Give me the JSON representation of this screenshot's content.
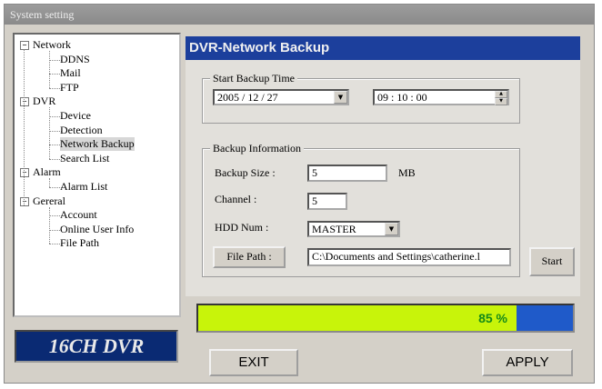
{
  "window": {
    "title": "System setting"
  },
  "tree": [
    {
      "label": "Network",
      "level": 0,
      "toggle": "−"
    },
    {
      "label": "DDNS",
      "level": 1
    },
    {
      "label": "Mail",
      "level": 1
    },
    {
      "label": "FTP",
      "level": 1
    },
    {
      "label": "DVR",
      "level": 0,
      "toggle": "−"
    },
    {
      "label": "Device",
      "level": 1
    },
    {
      "label": "Detection",
      "level": 1
    },
    {
      "label": "Network Backup",
      "level": 1,
      "selected": true
    },
    {
      "label": "Search List",
      "level": 1
    },
    {
      "label": "Alarm",
      "level": 0,
      "toggle": "−"
    },
    {
      "label": "Alarm List",
      "level": 1
    },
    {
      "label": "Gereral",
      "level": 0,
      "toggle": "−"
    },
    {
      "label": "Account",
      "level": 1
    },
    {
      "label": "Online User Info",
      "level": 1
    },
    {
      "label": "File Path",
      "level": 1
    }
  ],
  "brand": "16CH DVR",
  "panel": {
    "title": "DVR-Network Backup",
    "start_group": {
      "legend": "Start Backup Time",
      "date": "2005 / 12 / 27",
      "time": "09 : 10 : 00"
    },
    "info_group": {
      "legend": "Backup Information",
      "size_label": "Backup Size :",
      "size_value": "5",
      "size_unit": "MB",
      "channel_label": "Channel :",
      "channel_value": "5",
      "hdd_label": "HDD Num :",
      "hdd_value": "MASTER",
      "filepath_button": "File Path :",
      "filepath_value": "C:\\Documents and Settings\\catherine.l"
    },
    "start_button": "Start"
  },
  "progress": {
    "percent": 85,
    "label": "85 %"
  },
  "buttons": {
    "exit": "EXIT",
    "apply": "APPLY"
  }
}
